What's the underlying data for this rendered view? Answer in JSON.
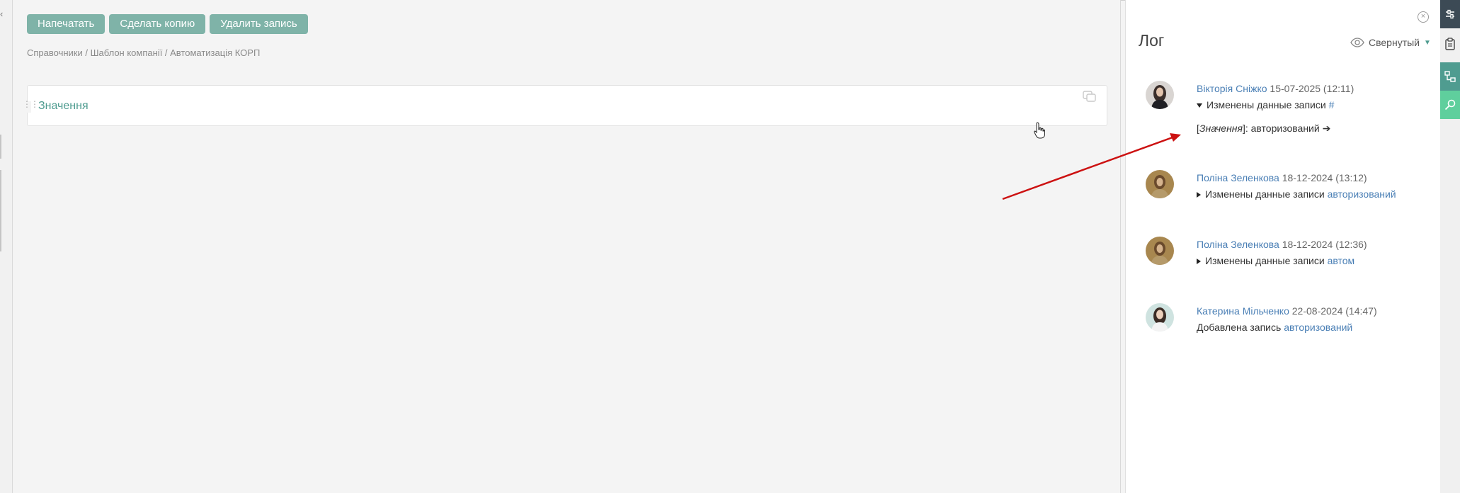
{
  "toolbar": {
    "print_label": "Напечатать",
    "copy_label": "Сделать копию",
    "delete_label": "Удалить запись"
  },
  "breadcrumb": "Справочники / Шаблон компанії / Автоматизація КОРП",
  "field": {
    "label": "Значення"
  },
  "log": {
    "title": "Лог",
    "view_label": "Свернутый",
    "entries": [
      {
        "author": "Вікторія Сніжко",
        "date": "15-07-2025 (12:11)",
        "action": "Изменены данные записи",
        "value": "#",
        "detail_field": "Значення",
        "detail_value": ": авторизований ➔"
      },
      {
        "author": "Поліна Зеленкова",
        "date": "18-12-2024 (13:12)",
        "action": "Изменены данные записи",
        "value": "авторизований"
      },
      {
        "author": "Поліна Зеленкова",
        "date": "18-12-2024 (12:36)",
        "action": "Изменены данные записи",
        "value": "автом"
      },
      {
        "author": "Катерина Мільченко",
        "date": "22-08-2024 (14:47)",
        "action": "Добавлена запись",
        "value": "авторизований"
      }
    ]
  },
  "colors": {
    "accent": "#7fb3a8",
    "link": "#4a7fb5",
    "field_label": "#4f9c90",
    "annotation_arrow": "#cc1111"
  }
}
